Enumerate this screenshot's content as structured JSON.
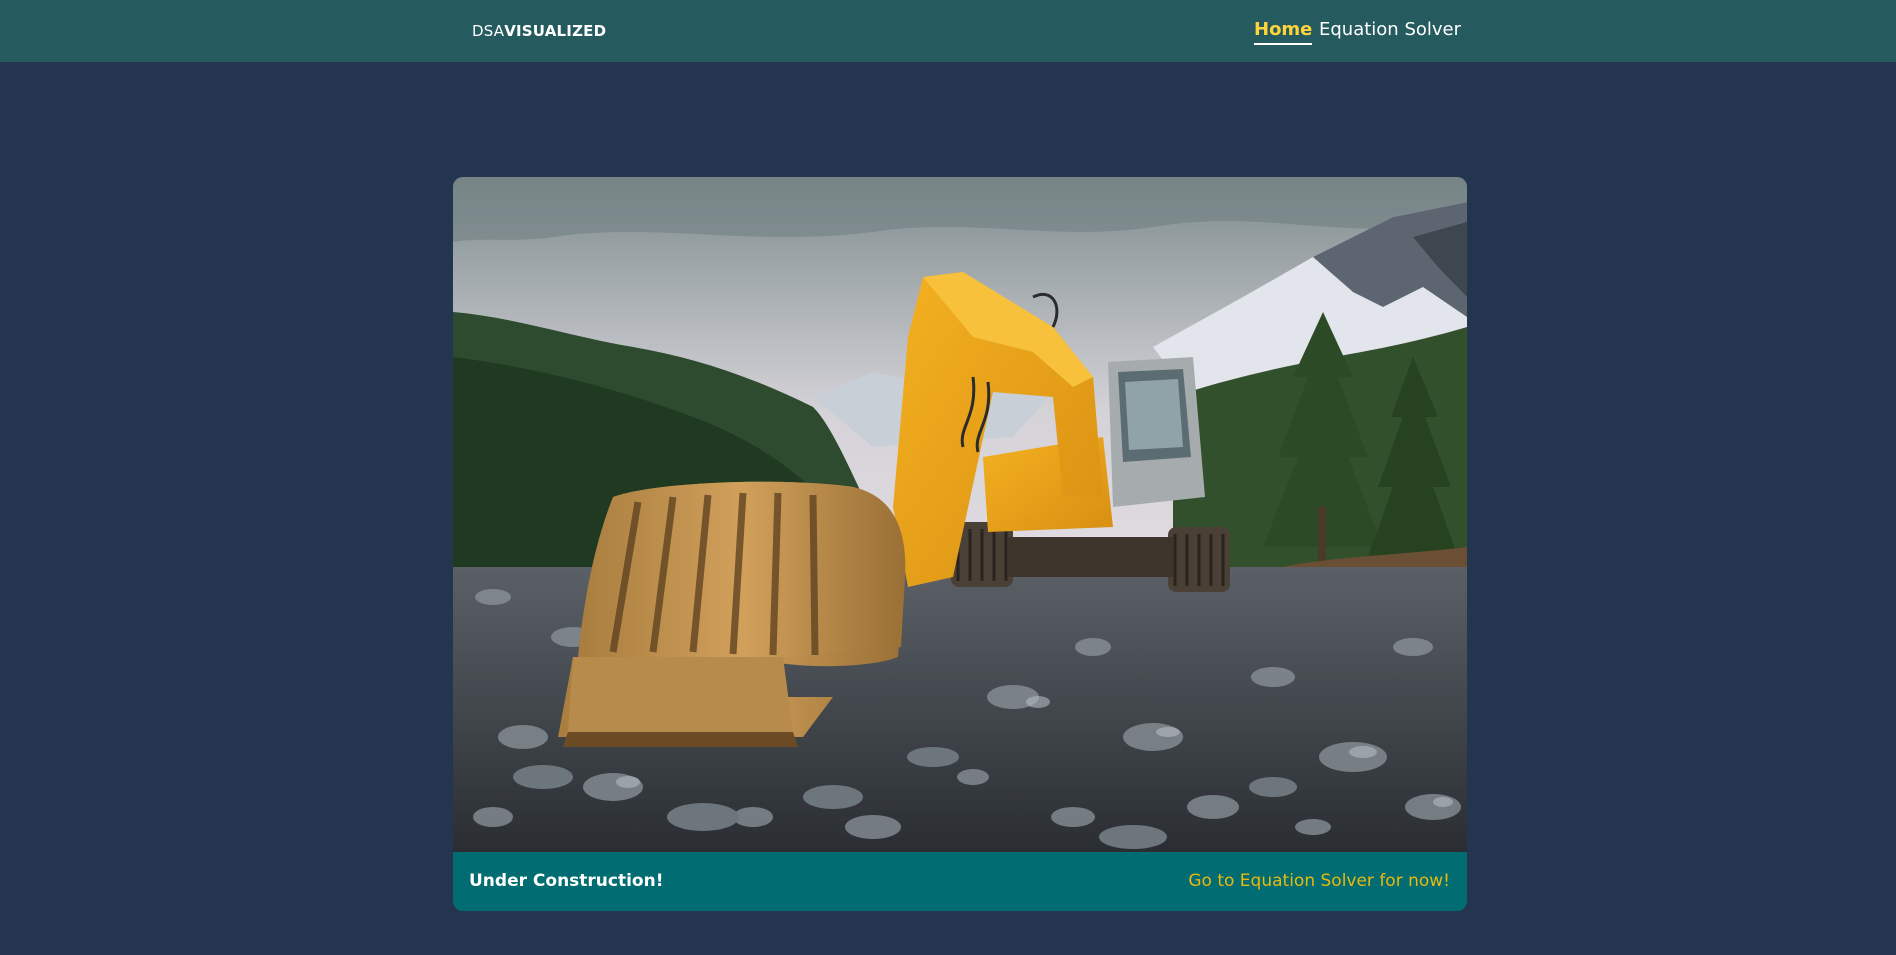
{
  "nav": {
    "brand_prefix": "DSA",
    "brand_bold": "VISUALIZED",
    "links": [
      {
        "label": "Home",
        "active": true
      },
      {
        "label": "Equation Solver",
        "active": false
      }
    ]
  },
  "card": {
    "image_alt": "Under construction",
    "title": "Under Construction!",
    "link_text": "Go to Equation Solver for now!"
  },
  "colors": {
    "background": "#24364f",
    "navbar": "#255b5f",
    "active_link": "#ffd43b",
    "card_footer": "#016c71",
    "footer_link": "#e8b90f"
  }
}
